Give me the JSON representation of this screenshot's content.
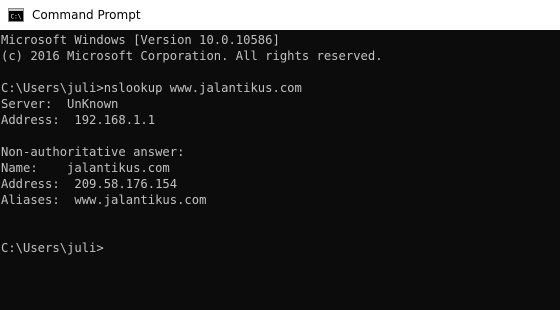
{
  "window": {
    "title": "Command Prompt",
    "icon": "cmd-icon",
    "colors": {
      "titlebar_bg": "#ffffff",
      "console_bg": "#0c0c0c",
      "console_text": "#c0c0c0"
    }
  },
  "console": {
    "lines": [
      "Microsoft Windows [Version 10.0.10586]",
      "(c) 2016 Microsoft Corporation. All rights reserved.",
      "",
      "C:\\Users\\juli>nslookup www.jalantikus.com",
      "Server:  UnKnown",
      "Address:  192.168.1.1",
      "",
      "Non-authoritative answer:",
      "Name:    jalantikus.com",
      "Address:  209.58.176.154",
      "Aliases:  www.jalantikus.com",
      "",
      "",
      "C:\\Users\\juli>"
    ]
  }
}
